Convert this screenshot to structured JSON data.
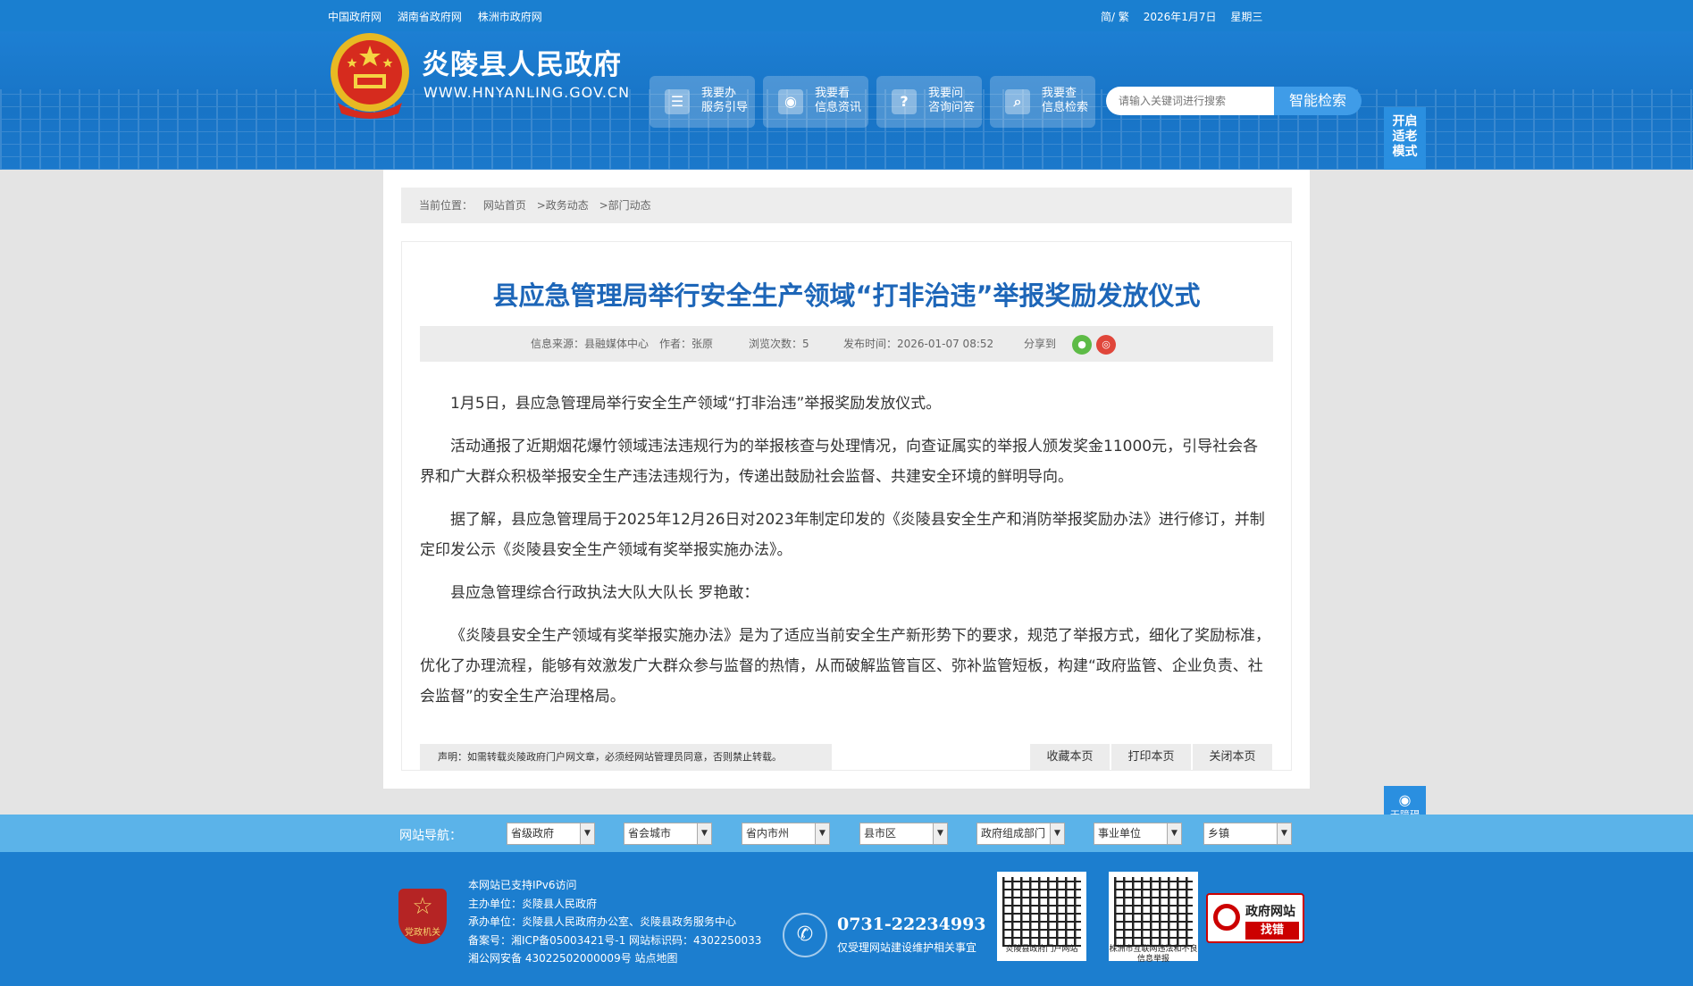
{
  "topbar": {
    "links": [
      "中国政府网",
      "湖南省政府网",
      "株洲市政府网"
    ],
    "lang": "简/ 繁",
    "date": "2026年1月7日",
    "weekday": "星期三"
  },
  "header": {
    "site_name": "炎陵县人民政府",
    "site_url": "WWW.HNYANLING.GOV.CN",
    "buttons": [
      {
        "line1": "我要办",
        "line2": "服务引导",
        "icon": "form-icon"
      },
      {
        "line1": "我要看",
        "line2": "信息资讯",
        "icon": "eye-icon"
      },
      {
        "line1": "我要问",
        "line2": "咨询问答",
        "icon": "question-icon"
      },
      {
        "line1": "我要查",
        "line2": "信息检索",
        "icon": "search-icon"
      }
    ],
    "search_placeholder": "请输入关键词进行搜索",
    "search_button": "智能检索",
    "elder_mode": "开启适老模式"
  },
  "breadcrumb": {
    "label": "当前位置：",
    "items": [
      "网站首页",
      ">政务动态",
      ">部门动态"
    ]
  },
  "article": {
    "title": "县应急管理局举行安全生产领域“打非治违”举报奖励发放仪式",
    "meta": {
      "source": "信息来源：县融媒体中心",
      "author": "作者：张原",
      "views": "浏览次数：5",
      "published": "发布时间：2026-01-07 08:52",
      "share": "分享到"
    },
    "paragraphs": [
      "1月5日，县应急管理局举行安全生产领域“打非治违”举报奖励发放仪式。",
      "活动通报了近期烟花爆竹领域违法违规行为的举报核查与处理情况，向查证属实的举报人颁发奖金11000元，引导社会各界和广大群众积极举报安全生产违法违规行为，传递出鼓励社会监督、共建安全环境的鲜明导向。",
      "据了解，县应急管理局于2025年12月26日对2023年制定印发的《炎陵县安全生产和消防举报奖励办法》进行修订，并制定印发公示《炎陵县安全生产领域有奖举报实施办法》。",
      "县应急管理综合行政执法大队大队长 罗艳敢：",
      "《炎陵县安全生产领域有奖举报实施办法》是为了适应当前安全生产新形势下的要求，规范了举报方式，细化了奖励标准，优化了办理流程，能够有效激发广大群众参与监督的热情，从而破解监管盲区、弥补监管短板，构建“政府监管、企业负责、社会监督”的安全生产治理格局。"
    ],
    "notice": "声明：如需转载炎陵政府门户网文章，必须经网站管理员同意，否则禁止转载。",
    "tools": [
      "收藏本页",
      "打印本页",
      "关闭本页"
    ]
  },
  "nav": {
    "label": "网站导航：",
    "selects": [
      "省级政府",
      "省会城市",
      "省内市州",
      "县市区",
      "政府组成部门",
      "事业单位",
      "乡镇"
    ]
  },
  "footer": {
    "party_label": "党政机关",
    "info": [
      "本网站已支持IPv6访问",
      "主办单位：炎陵县人民政府",
      "承办单位：炎陵县人民政府办公室、炎陵县政务服务中心",
      "备案号：湘ICP备05003421号-1 网站标识码：4302250033",
      "湘公网安备 43022502000009号 站点地图"
    ],
    "phone": "0731-22234993",
    "phone_note": "仅受理网站建设维护相关事宜",
    "qr1_caption": "炎陵县政府门户网站",
    "qr2_caption": "株洲市互联网违法和不良信息举报",
    "zhaocuo_line1": "政府网站",
    "zhaocuo_line2": "找错",
    "accessibility": "无障碍浏览"
  },
  "colors": {
    "header_blue": "#1874c6",
    "title_blue": "#1d66b8",
    "nav_light_blue": "#5bb3e9"
  }
}
